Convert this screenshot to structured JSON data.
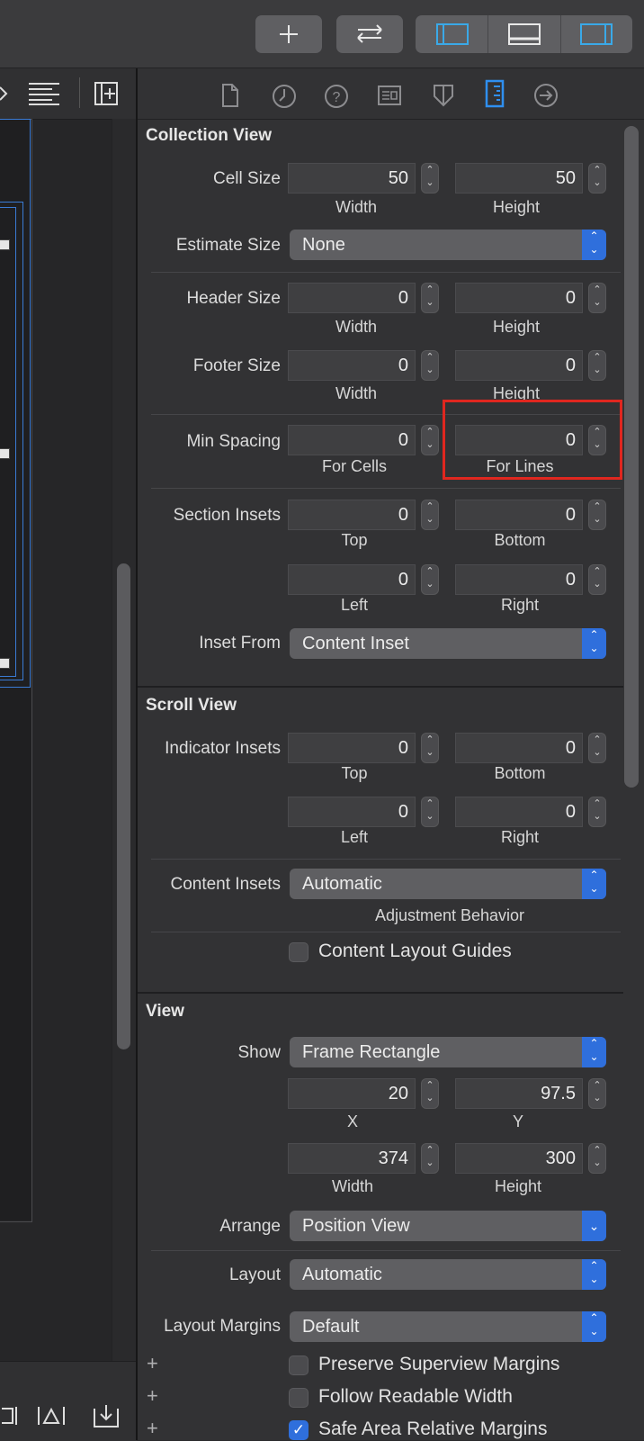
{
  "toolbar": {
    "add_button_icon": "plus-icon",
    "swap_button_icon": "arrows-left-right-icon",
    "panel_icons": [
      "left-panel-icon",
      "bottom-panel-icon",
      "right-panel-icon"
    ]
  },
  "inspector_tabs": [
    {
      "icon": "file-icon",
      "glyph": "🗋"
    },
    {
      "icon": "history-icon",
      "glyph": "◷"
    },
    {
      "icon": "help-icon",
      "glyph": "?"
    },
    {
      "icon": "identity-icon",
      "glyph": "▤"
    },
    {
      "icon": "attributes-icon",
      "glyph": "⛉"
    },
    {
      "icon": "size-icon",
      "glyph": "▮"
    },
    {
      "icon": "connections-icon",
      "glyph": "→"
    }
  ],
  "collection_view": {
    "title": "Collection View",
    "cell_size": {
      "label": "Cell Size",
      "width": "50",
      "height": "50",
      "width_label": "Width",
      "height_label": "Height"
    },
    "estimate_size": {
      "label": "Estimate Size",
      "value": "None"
    },
    "header_size": {
      "label": "Header Size",
      "width": "0",
      "height": "0",
      "width_label": "Width",
      "height_label": "Height"
    },
    "footer_size": {
      "label": "Footer Size",
      "width": "0",
      "height": "0",
      "width_label": "Width",
      "height_label": "Height"
    },
    "min_spacing": {
      "label": "Min Spacing",
      "cells": "0",
      "lines": "0",
      "cells_label": "For Cells",
      "lines_label": "For Lines"
    },
    "section_insets": {
      "label": "Section Insets",
      "top": "0",
      "bottom": "0",
      "left": "0",
      "right": "0",
      "top_label": "Top",
      "bottom_label": "Bottom",
      "left_label": "Left",
      "right_label": "Right"
    },
    "inset_from": {
      "label": "Inset From",
      "value": "Content Inset"
    }
  },
  "scroll_view": {
    "title": "Scroll View",
    "indicator_insets": {
      "label": "Indicator Insets",
      "top": "0",
      "bottom": "0",
      "left": "0",
      "right": "0",
      "top_label": "Top",
      "bottom_label": "Bottom",
      "left_label": "Left",
      "right_label": "Right"
    },
    "content_insets": {
      "label": "Content Insets",
      "value": "Automatic",
      "sublabel": "Adjustment Behavior"
    },
    "content_layout_guides": {
      "label": "Content Layout Guides",
      "checked": false
    }
  },
  "view": {
    "title": "View",
    "show": {
      "label": "Show",
      "value": "Frame Rectangle"
    },
    "x": "20",
    "y": "97.5",
    "x_label": "X",
    "y_label": "Y",
    "width": "374",
    "height": "300",
    "width_label": "Width",
    "height_label": "Height",
    "arrange": {
      "label": "Arrange",
      "value": "Position View"
    },
    "layout": {
      "label": "Layout",
      "value": "Automatic"
    },
    "layout_margins": {
      "label": "Layout Margins",
      "value": "Default"
    },
    "checkboxes": [
      {
        "label": "Preserve Superview Margins",
        "checked": false
      },
      {
        "label": "Follow Readable Width",
        "checked": false
      },
      {
        "label": "Safe Area Relative Margins",
        "checked": true
      }
    ]
  },
  "colors": {
    "accent": "#2f6fdc",
    "highlight": "#e0271f",
    "panel": "#323234"
  }
}
